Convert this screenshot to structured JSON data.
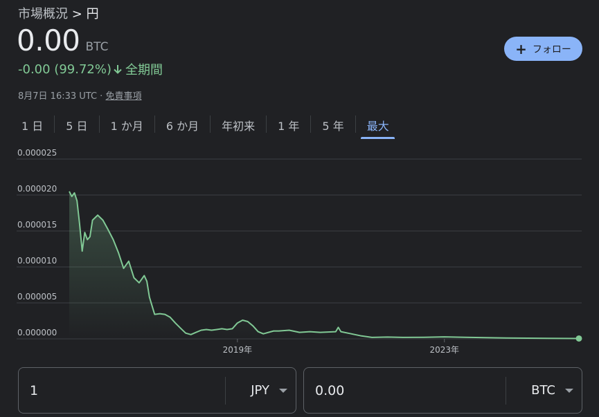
{
  "breadcrumb": {
    "parent": "市場概況",
    "sep": ">",
    "current": "円"
  },
  "quote": {
    "price": "0.00",
    "unit": "BTC",
    "change": "-0.00 (99.72%)",
    "period": "全期間",
    "timestamp": "8月7日 16:33 UTC · ",
    "disclaimer": "免責事項"
  },
  "follow": {
    "label": "フォロー",
    "icon": "plus-icon"
  },
  "ranges": [
    {
      "label": "1 日",
      "active": false
    },
    {
      "label": "5 日",
      "active": false
    },
    {
      "label": "1 か月",
      "active": false
    },
    {
      "label": "6 か月",
      "active": false
    },
    {
      "label": "年初来",
      "active": false
    },
    {
      "label": "1 年",
      "active": false
    },
    {
      "label": "5 年",
      "active": false
    },
    {
      "label": "最大",
      "active": true
    }
  ],
  "converter": {
    "from": {
      "value": "1",
      "currency": "JPY"
    },
    "to": {
      "value": "0.00",
      "currency": "BTC"
    }
  },
  "colors": {
    "line": "#81c995",
    "accent": "#8ab4f8",
    "grid": "#3c4043",
    "bg": "#202124"
  },
  "chart_data": {
    "type": "line",
    "title": "",
    "xlabel": "",
    "ylabel": "",
    "ylim": [
      0,
      2.5e-05
    ],
    "yticks": [
      2.5e-05,
      2e-05,
      1.5e-05,
      1e-05,
      5e-06,
      0
    ],
    "ytick_labels": [
      "0.000025",
      "0.000020",
      "0.000015",
      "0.000010",
      "0.000005",
      "0.000000"
    ],
    "xlim": [
      2015.75,
      2025.6
    ],
    "xticks": [
      2019,
      2023
    ],
    "xtick_labels": [
      "2019年",
      "2023年"
    ],
    "grid": true,
    "series": [
      {
        "x": [
          2015.75,
          2015.8,
          2015.85,
          2015.9,
          2015.95,
          2016.0,
          2016.05,
          2016.1,
          2016.15,
          2016.2,
          2016.3,
          2016.4,
          2016.5,
          2016.6,
          2016.7,
          2016.8,
          2016.9,
          2017.0,
          2017.1,
          2017.2,
          2017.25,
          2017.3,
          2017.4,
          2017.5,
          2017.6,
          2017.7,
          2017.8,
          2017.9,
          2018.0,
          2018.1,
          2018.2,
          2018.3,
          2018.4,
          2018.5,
          2018.6,
          2018.7,
          2018.8,
          2018.9,
          2019.0,
          2019.1,
          2019.2,
          2019.3,
          2019.4,
          2019.5,
          2019.6,
          2019.7,
          2019.8,
          2020.0,
          2020.2,
          2020.4,
          2020.6,
          2020.9,
          2020.95,
          2021.0,
          2021.2,
          2021.4,
          2021.6,
          2021.9,
          2022.2,
          2022.6,
          2023.0,
          2023.4,
          2023.8,
          2024.2,
          2024.6,
          2025.0,
          2025.3,
          2025.6
        ],
        "y": [
          2.05e-05,
          1.98e-05,
          2.03e-05,
          1.92e-05,
          1.6e-05,
          1.22e-05,
          1.48e-05,
          1.38e-05,
          1.42e-05,
          1.65e-05,
          1.72e-05,
          1.65e-05,
          1.52e-05,
          1.38e-05,
          1.2e-05,
          9.8e-06,
          1.08e-05,
          8.5e-06,
          7.8e-06,
          8.8e-06,
          8e-06,
          5.8e-06,
          3.4e-06,
          3.5e-06,
          3.4e-06,
          3e-06,
          2.2e-06,
          1.5e-06,
          8e-07,
          6e-07,
          9e-07,
          1.2e-06,
          1.3e-06,
          1.2e-06,
          1.3e-06,
          1.4e-06,
          1.3e-06,
          1.4e-06,
          2.2e-06,
          2.6e-06,
          2.4e-06,
          1.8e-06,
          1e-06,
          7e-07,
          9e-07,
          1.1e-06,
          1.1e-06,
          1.2e-06,
          9e-07,
          1e-06,
          9e-07,
          1e-06,
          1.6e-06,
          1e-06,
          7e-07,
          4e-07,
          2e-07,
          2.5e-07,
          2e-07,
          2.2e-07,
          2.8e-07,
          2.2e-07,
          1.6e-07,
          1.2e-07,
          1e-07,
          8e-08,
          6e-08,
          5e-08
        ]
      }
    ]
  }
}
